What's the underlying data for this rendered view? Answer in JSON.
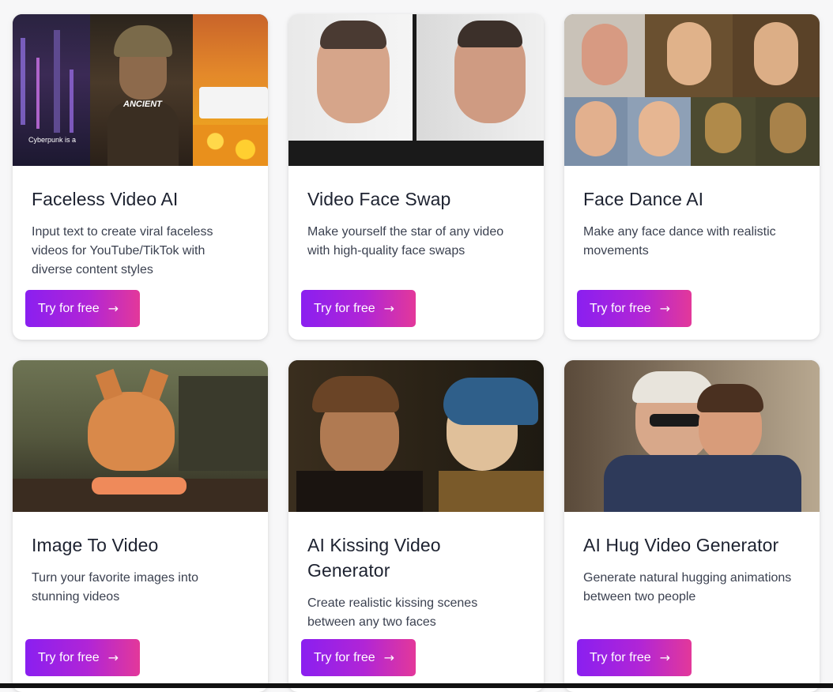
{
  "cards": [
    {
      "title": "Faceless Video AI",
      "description": "Input text to create viral faceless videos for YouTube/TikTok with diverse content styles",
      "button": "Try for free",
      "thumb_text": {
        "cyber": "Cyberpunk is a",
        "ancient": "ANCIENT"
      }
    },
    {
      "title": "Video Face Swap",
      "description": "Make yourself the star of any video with high-quality face swaps",
      "button": "Try for free"
    },
    {
      "title": "Face Dance AI",
      "description": "Make any face dance with realistic movements",
      "button": "Try for free"
    },
    {
      "title": "Image To Video",
      "description": "Turn your favorite images into stunning videos",
      "button": "Try for free"
    },
    {
      "title": "AI Kissing Video Generator",
      "description": "Create realistic kissing scenes between any two faces",
      "button": "Try for free"
    },
    {
      "title": "AI Hug Video Generator",
      "description": "Generate natural hugging animations between two people",
      "button": "Try for free"
    }
  ],
  "icons": {
    "button_arrow": "arrow-right-icon"
  },
  "colors": {
    "button_start": "#8a1ff0",
    "button_end": "#e3389a",
    "card_bg": "#ffffff",
    "page_bg": "#f7f7f8"
  }
}
